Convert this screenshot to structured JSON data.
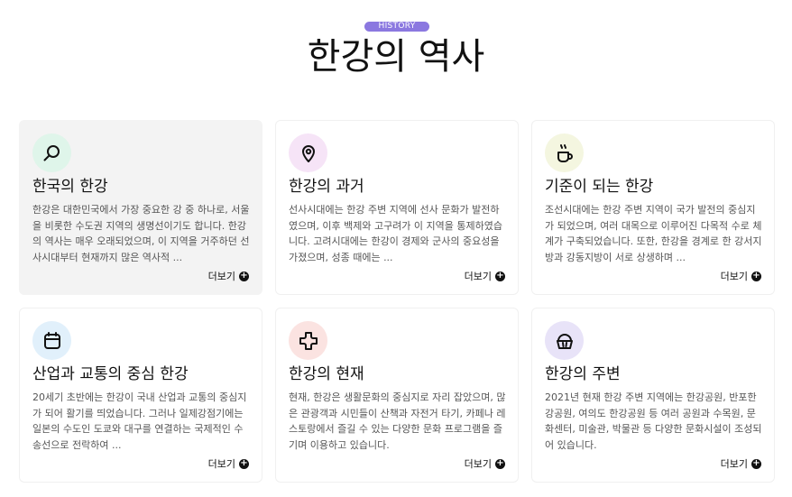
{
  "header": {
    "badge": "HISTORY",
    "title": "한강의 역사"
  },
  "more_label": "더보기",
  "cards": [
    {
      "icon": "search-icon",
      "icon_bg": "#dff5ea",
      "title": "한국의 한강",
      "desc": "한강은 대한민국에서 가장 중요한 강 중 하나로, 서울을 비롯한 수도권 지역의 생명선이기도 합니다. 한강의 역사는 매우 오래되었으며, 이 지역을 거주하던 선사시대부터 현재까지 많은 역사적 ..."
    },
    {
      "icon": "map-pin-icon",
      "icon_bg": "#f6e4f7",
      "title": "한강의 과거",
      "desc": "선사시대에는 한강 주변 지역에 선사 문화가 발전하였으며, 이후 백제와 고구려가 이 지역을 통제하였습니다. 고려시대에는 한강이 경제와 군사의 중요성을 가졌으며, 성종 때에는 ..."
    },
    {
      "icon": "coffee-cup-icon",
      "icon_bg": "#f4f6e0",
      "title": "기준이 되는 한강",
      "desc": "조선시대에는 한강 주변 지역이 국가 발전의 중심지가 되었으며, 여러 대목으로 이루어진 다목적 수로 체계가 구축되었습니다. 또한, 한강을 경계로 한 강서지방과 강동지방이 서로 상생하며 ..."
    },
    {
      "icon": "calendar-icon",
      "icon_bg": "#e1f0fb",
      "title": "산업과 교통의 중심 한강",
      "desc": "20세기 초반에는 한강이 국내 산업과 교통의 중심지가 되어 활기를 띄었습니다. 그러나 일제강점기에는 일본의 수도인 도쿄와 대구를 연결하는 국제적인 수송선으로 전락하여 ..."
    },
    {
      "icon": "puzzle-cross-icon",
      "icon_bg": "#fbe3e1",
      "title": "한강의 현재",
      "desc": "현재, 한강은 생활문화의 중심지로 자리 잡았으며, 많은 관광객과 시민들이 산책과 자전거 타기, 카페나 레스토랑에서 즐길 수 있는 다양한 문화 프로그램을 즐기며 이용하고 있습니다."
    },
    {
      "icon": "cupcake-icon",
      "icon_bg": "#e8e3f8",
      "title": "한강의 주변",
      "desc": "2021년 현재 한강 주변 지역에는 한강공원, 반포한강공원, 여의도 한강공원 등 여러 공원과 수목원, 문화센터, 미술관, 박물관 등 다양한 문화시설이 조성되어 있습니다."
    }
  ]
}
